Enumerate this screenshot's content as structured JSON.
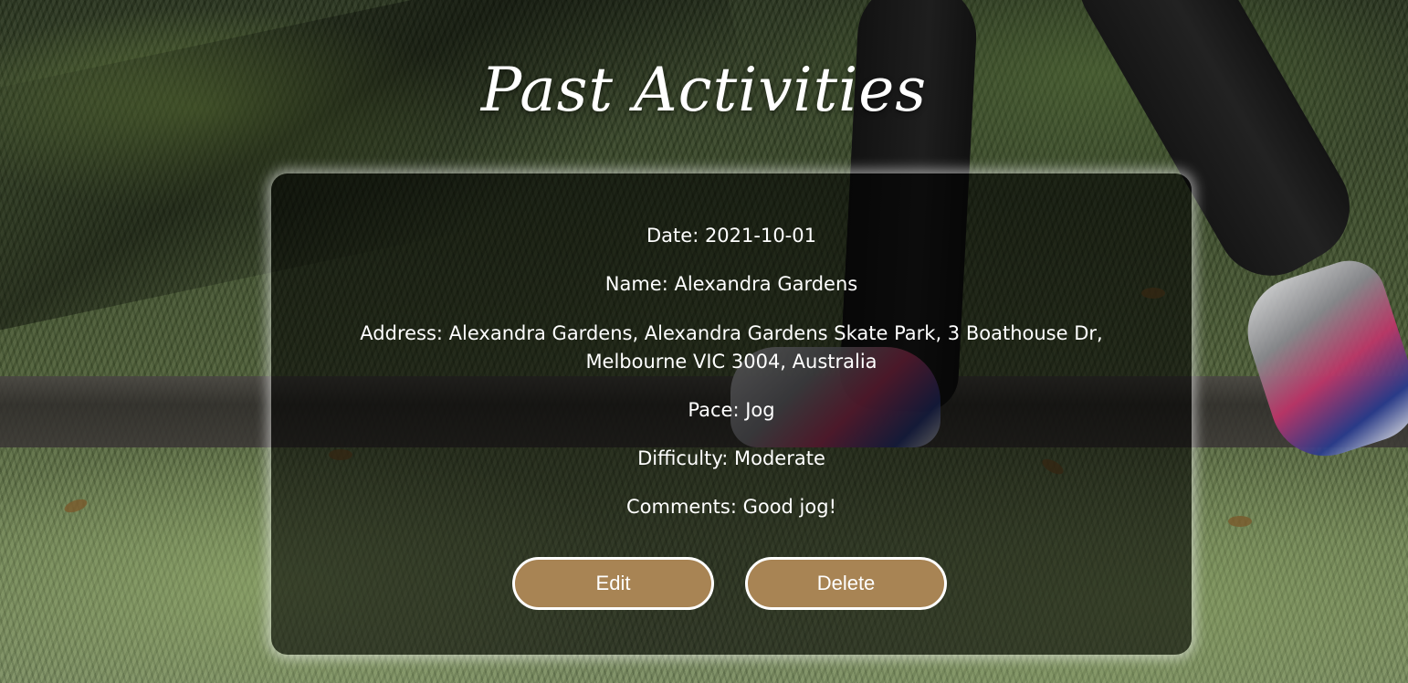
{
  "page": {
    "title": "Past Activities"
  },
  "activity": {
    "date": "Date: 2021-10-01",
    "name": "Name: Alexandra Gardens",
    "address": "Address: Alexandra Gardens, Alexandra Gardens Skate Park, 3 Boathouse Dr, Melbourne VIC 3004, Australia",
    "pace": "Pace: Jog",
    "difficulty": "Difficulty: Moderate",
    "comments": "Comments: Good jog!"
  },
  "actions": {
    "edit_label": "Edit",
    "delete_label": "Delete"
  },
  "colors": {
    "button_fill": "#a88454",
    "button_border": "#ffffff",
    "card_overlay": "rgba(0,0,0,0.58)",
    "text": "#ffffff"
  }
}
